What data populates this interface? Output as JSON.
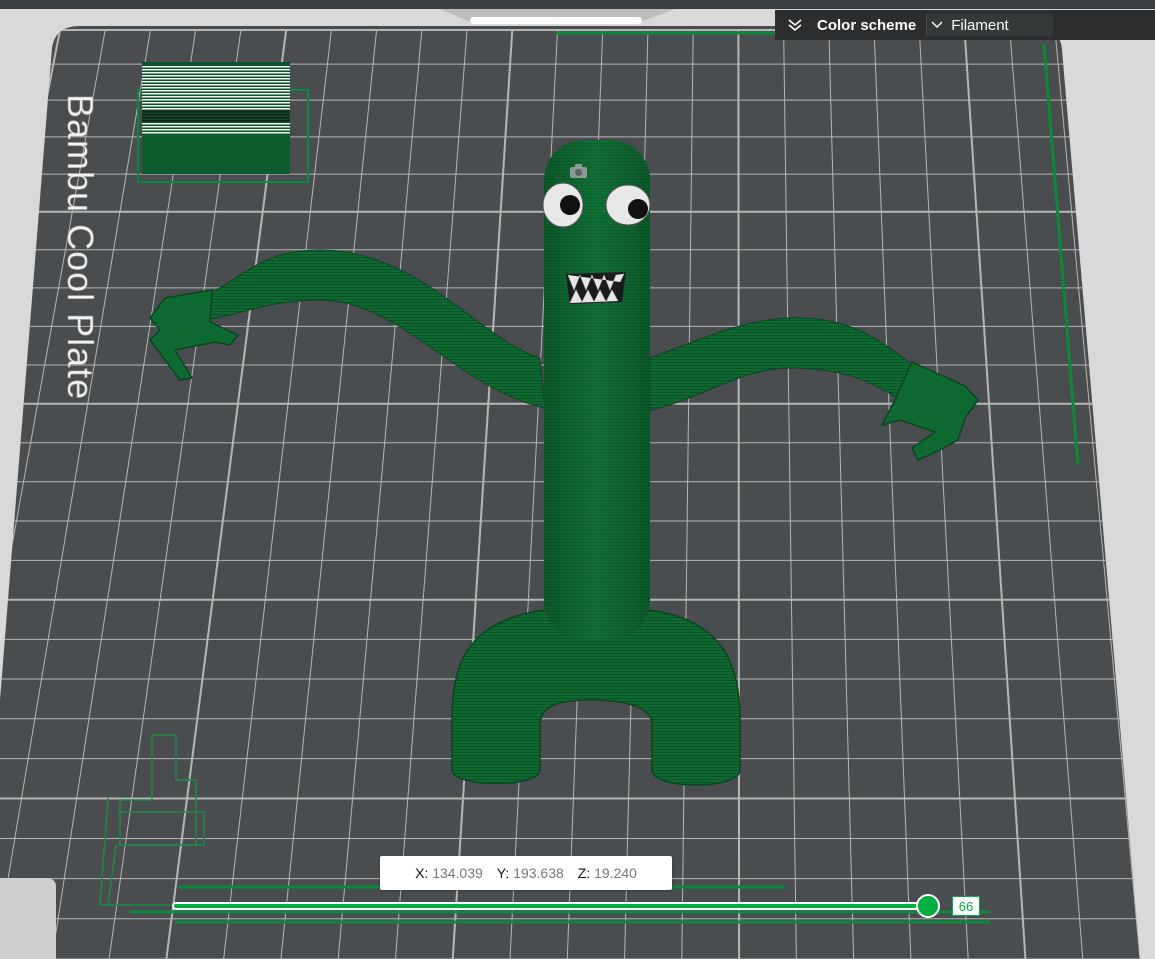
{
  "plate": {
    "name": "Bambu Cool Plate"
  },
  "color_panel": {
    "title": "Color scheme",
    "scheme_value": "Filament"
  },
  "coordinates": {
    "x_label": "X:",
    "x_value": "134.039",
    "y_label": "Y:",
    "y_value": "193.638",
    "z_label": "Z:",
    "z_value": "19.240"
  },
  "layer_slider": {
    "value": "66",
    "fill_fraction": 1.0
  },
  "colors": {
    "plate": "#4a4d4f",
    "grid": "#c9c9c9",
    "filament": "#0d5c2c",
    "accent": "#00ae42",
    "panel": "#2b2d2e"
  },
  "icons": {
    "camera": "camera-icon",
    "collapse": "chevron-double-down-icon",
    "dropdown": "chevron-down-icon"
  }
}
